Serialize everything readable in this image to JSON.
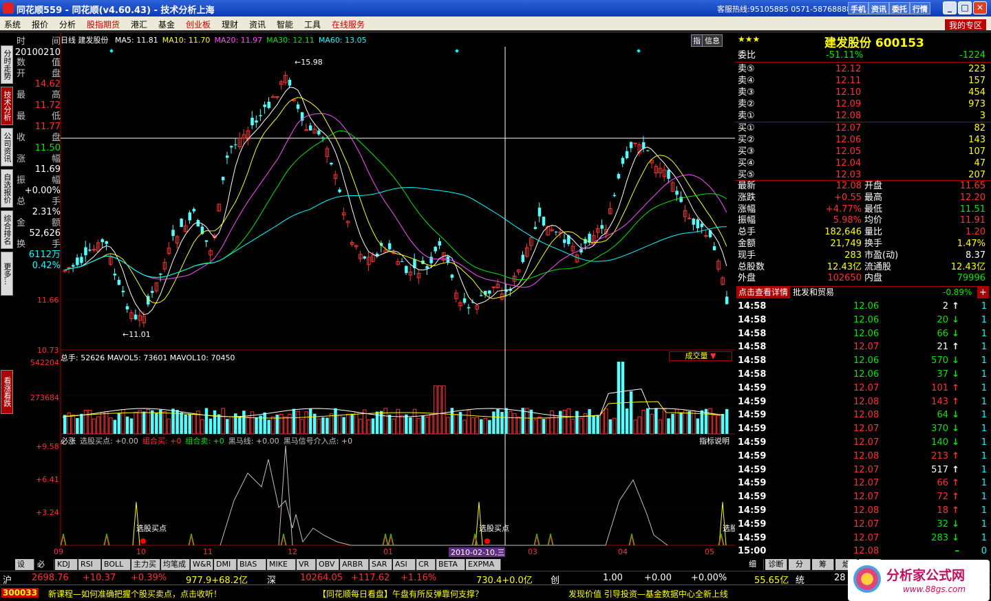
{
  "window": {
    "title": "同花顺559 - 同花顺(v4.60.43) - 技术分析上海",
    "hotline": "客服热线:95105885 0571-58768888",
    "buttons": [
      "手机",
      "资讯",
      "委托",
      "行情"
    ],
    "win_buttons": [
      "_",
      "□",
      "✕"
    ]
  },
  "menu": {
    "items": [
      "系统",
      "报价",
      "分析",
      "股指期货",
      "港汇",
      "基金",
      "创业板",
      "理财",
      "资讯",
      "智能",
      "工具",
      "在线服务"
    ],
    "my_zone": "我的专区"
  },
  "left_tabs": [
    "分时走势",
    "技术分析",
    "公司资讯",
    "自选报价",
    "综合排名",
    "更多..."
  ],
  "left_tab_bottom": "看涨看跌",
  "data_window": [
    {
      "k": "时",
      "v": "间"
    },
    {
      "k": "",
      "v": "20100210"
    },
    {
      "k": "数",
      "v": "值"
    },
    {
      "k": "开",
      "v": "盘"
    },
    {
      "k": "",
      "v": "14.62"
    },
    {
      "k": "最",
      "v": "高"
    },
    {
      "k": "",
      "v": "11.72"
    },
    {
      "k": "最",
      "v": "低"
    },
    {
      "k": "",
      "v": "11.77"
    },
    {
      "k": "收",
      "v": "盘"
    },
    {
      "k": "",
      "v": "11.50"
    },
    {
      "k": "涨",
      "v": "幅"
    },
    {
      "k": "",
      "v": "11.69"
    },
    {
      "k": "振",
      "v": "幅"
    },
    {
      "k": "",
      "v": "+0.00%"
    },
    {
      "k": "总",
      "v": "手"
    },
    {
      "k": "",
      "v": "2.31%"
    },
    {
      "k": "金",
      "v": "额"
    },
    {
      "k": "",
      "v": "52,626"
    },
    {
      "k": "换",
      "v": "手"
    },
    {
      "k": "",
      "v": "6112万"
    },
    {
      "k": "",
      "v": "0.42%"
    }
  ],
  "main_chart": {
    "period": "日线",
    "name": "建发股份",
    "ma": [
      {
        "label": "MA5: 11.81",
        "color": "#ffffff"
      },
      {
        "label": "MA10: 11.70",
        "color": "#ffff00"
      },
      {
        "label": "MA20: 11.97",
        "color": "#ff50ff"
      },
      {
        "label": "MA30: 12.11",
        "color": "#00e600"
      },
      {
        "label": "MA60: 13.05",
        "color": "#00ffff"
      }
    ],
    "info_btn": "信息",
    "zhi_btn": "指",
    "high_label": "15.98",
    "low_label": "11.01",
    "y_ticks": [
      "11.66",
      "10.73"
    ]
  },
  "volume_chart": {
    "header": "总手: 52626  MAVOL5: 73601  MAVOL10: 70450",
    "y_ticks": [
      "542204",
      "273684"
    ],
    "dropdown": "成交量"
  },
  "indicator_chart": {
    "header": [
      {
        "t": "必涨",
        "c": "#ffffff"
      },
      {
        "t": "选股买点: +0.00",
        "c": "#c0c0c0"
      },
      {
        "t": "组合买: +0",
        "c": "#ff3232"
      },
      {
        "t": "组合卖: +0",
        "c": "#00e600"
      },
      {
        "t": "黑马线: +0.00",
        "c": "#c0c0c0"
      },
      {
        "t": "黑马信号介入点: +0",
        "c": "#c0c0c0"
      }
    ],
    "explain": "指标说明",
    "y_ticks": [
      "+9.58",
      "+6.41",
      "+3.24"
    ],
    "signal_label": "选股买点",
    "signal_label_cut": "选股"
  },
  "x_axis": {
    "labels": [
      "09",
      "10",
      "11",
      "12",
      "01",
      "03",
      "04",
      "05"
    ],
    "cursor_date": "2010-02-10,三"
  },
  "bottom_tabs": [
    "设置",
    "必涨",
    "KDJ",
    "RSI",
    "BOLL",
    "主力买卖",
    "均笔成交",
    "W&R",
    "DMI",
    "BIAS",
    "MIKE",
    "VR",
    "OBV",
    "ARBR",
    "SAR",
    "ASI",
    "CR",
    "BETA",
    "EXPMA"
  ],
  "right_tabs": [
    "细",
    "诊断",
    "分",
    "筹",
    "焰",
    "财"
  ],
  "quote": {
    "stars": "★★★",
    "title": "建发股份 600153",
    "weibi": {
      "label": "委比",
      "pct": "-51.11%",
      "val": "-1224"
    },
    "sells": [
      {
        "l": "卖⑤",
        "p": "12.12",
        "v": "223"
      },
      {
        "l": "卖④",
        "p": "12.11",
        "v": "157"
      },
      {
        "l": "卖③",
        "p": "12.10",
        "v": "454"
      },
      {
        "l": "卖②",
        "p": "12.09",
        "v": "973"
      },
      {
        "l": "卖①",
        "p": "12.08",
        "v": "3"
      }
    ],
    "buys": [
      {
        "l": "买①",
        "p": "12.07",
        "v": "82"
      },
      {
        "l": "买②",
        "p": "12.06",
        "v": "143"
      },
      {
        "l": "买③",
        "p": "12.05",
        "v": "107"
      },
      {
        "l": "买④",
        "p": "12.04",
        "v": "47"
      },
      {
        "l": "买⑤",
        "p": "12.03",
        "v": "207"
      }
    ],
    "stats": [
      {
        "l1": "最新",
        "v1": "12.08",
        "c1": "red",
        "l2": "开盘",
        "v2": "11.65",
        "c2": "red"
      },
      {
        "l1": "涨跌",
        "v1": "+0.55",
        "c1": "red",
        "l2": "最高",
        "v2": "12.20",
        "c2": "red"
      },
      {
        "l1": "涨幅",
        "v1": "+4.77%",
        "c1": "red",
        "l2": "最低",
        "v2": "11.51",
        "c2": "green"
      },
      {
        "l1": "振幅",
        "v1": "5.98%",
        "c1": "red",
        "l2": "均价",
        "v2": "11.91",
        "c2": "red"
      },
      {
        "l1": "总手",
        "v1": "182,646",
        "c1": "yellow",
        "l2": "量比",
        "v2": "1.20",
        "c2": "red"
      },
      {
        "l1": "金额",
        "v1": "21,749",
        "c1": "yellow",
        "l2": "换手",
        "v2": "1.47%",
        "c2": "yellow"
      },
      {
        "l1": "现手",
        "v1": "283",
        "c1": "yellow",
        "l2": "市盈(动)",
        "v2": "8.37",
        "c2": "white"
      },
      {
        "l1": "总股数",
        "v1": "12.43亿",
        "c1": "yellow",
        "l2": "流通股",
        "v2": "12.43亿",
        "c2": "yellow"
      },
      {
        "l1": "外盘",
        "v1": "102650",
        "c1": "red",
        "l2": "内盘",
        "v2": "79996",
        "c2": "green"
      }
    ],
    "detail_btn": "点击查看详情",
    "industry": "批发和贸易",
    "industry_pct": "-0.89%",
    "plus": "+"
  },
  "ticks": [
    {
      "t": "14:58",
      "p": "12.06",
      "v": "2",
      "d": "up",
      "n": "1"
    },
    {
      "t": "14:58",
      "p": "12.06",
      "v": "20",
      "d": "down",
      "n": "1"
    },
    {
      "t": "14:58",
      "p": "12.06",
      "v": "66",
      "d": "down",
      "n": "1"
    },
    {
      "t": "14:58",
      "p": "12.07",
      "v": "21",
      "d": "up",
      "n": "1"
    },
    {
      "t": "14:58",
      "p": "12.06",
      "v": "570",
      "d": "down",
      "n": "1"
    },
    {
      "t": "14:58",
      "p": "12.06",
      "v": "37",
      "d": "down",
      "n": "1"
    },
    {
      "t": "14:59",
      "p": "12.07",
      "v": "101",
      "d": "upr",
      "n": "1"
    },
    {
      "t": "14:59",
      "p": "12.08",
      "v": "143",
      "d": "upr",
      "n": "1"
    },
    {
      "t": "14:59",
      "p": "12.08",
      "v": "64",
      "d": "down",
      "n": "1"
    },
    {
      "t": "14:59",
      "p": "12.07",
      "v": "370",
      "d": "down",
      "n": "1"
    },
    {
      "t": "14:59",
      "p": "12.07",
      "v": "140",
      "d": "down",
      "n": "1"
    },
    {
      "t": "14:59",
      "p": "12.08",
      "v": "213",
      "d": "upr",
      "n": "1"
    },
    {
      "t": "14:59",
      "p": "12.07",
      "v": "517",
      "d": "up",
      "n": "1"
    },
    {
      "t": "14:59",
      "p": "12.07",
      "v": "66",
      "d": "upr",
      "n": "1"
    },
    {
      "t": "14:59",
      "p": "12.07",
      "v": "72",
      "d": "upr",
      "n": "1"
    },
    {
      "t": "14:59",
      "p": "12.08",
      "v": "18",
      "d": "upr",
      "n": "1"
    },
    {
      "t": "14:59",
      "p": "12.07",
      "v": "32",
      "d": "down",
      "n": "1"
    },
    {
      "t": "14:59",
      "p": "12.07",
      "v": "283",
      "d": "down",
      "n": "1"
    },
    {
      "t": "15:00",
      "p": "12.08",
      "v": "",
      "d": "dash",
      "n": "0"
    }
  ],
  "status": [
    {
      "t": "沪",
      "c": "white"
    },
    {
      "t": "2698.76",
      "c": "red"
    },
    {
      "t": "+10.37",
      "c": "red"
    },
    {
      "t": "+0.39%",
      "c": "red"
    },
    {
      "t": "977.9+68.2亿",
      "c": "yellow"
    },
    {
      "t": "深",
      "c": "white"
    },
    {
      "t": "10264.05",
      "c": "red"
    },
    {
      "t": "+117.62",
      "c": "red"
    },
    {
      "t": "+1.16%",
      "c": "red"
    },
    {
      "t": "730.4+0.0亿",
      "c": "yellow"
    },
    {
      "t": "创",
      "c": "white"
    },
    {
      "t": "1.00",
      "c": "white"
    },
    {
      "t": "+0.00",
      "c": "white"
    },
    {
      "t": "+0.00%",
      "c": "white"
    },
    {
      "t": "55.65亿",
      "c": "yellow"
    },
    {
      "t": "统",
      "c": "white"
    },
    {
      "t": "28",
      "c": "white"
    }
  ],
  "news": {
    "code": "300033",
    "items": [
      "新课程—如何准确把握个股买卖点，点击收听！",
      "【同花顺每日看盘】午盘有所反弹靠何支撑？",
      "发现价值 引导投资—基金数据中心全新上线"
    ]
  },
  "watermark": {
    "text": "分析家公式网",
    "url": "www.88gs.com"
  },
  "colors": {
    "up": "#ff3232",
    "down": "#54ffff",
    "ma5": "#ffffff",
    "ma10": "#ffff00",
    "ma20": "#ff50ff",
    "ma30": "#00e600",
    "ma60": "#00ffff"
  }
}
